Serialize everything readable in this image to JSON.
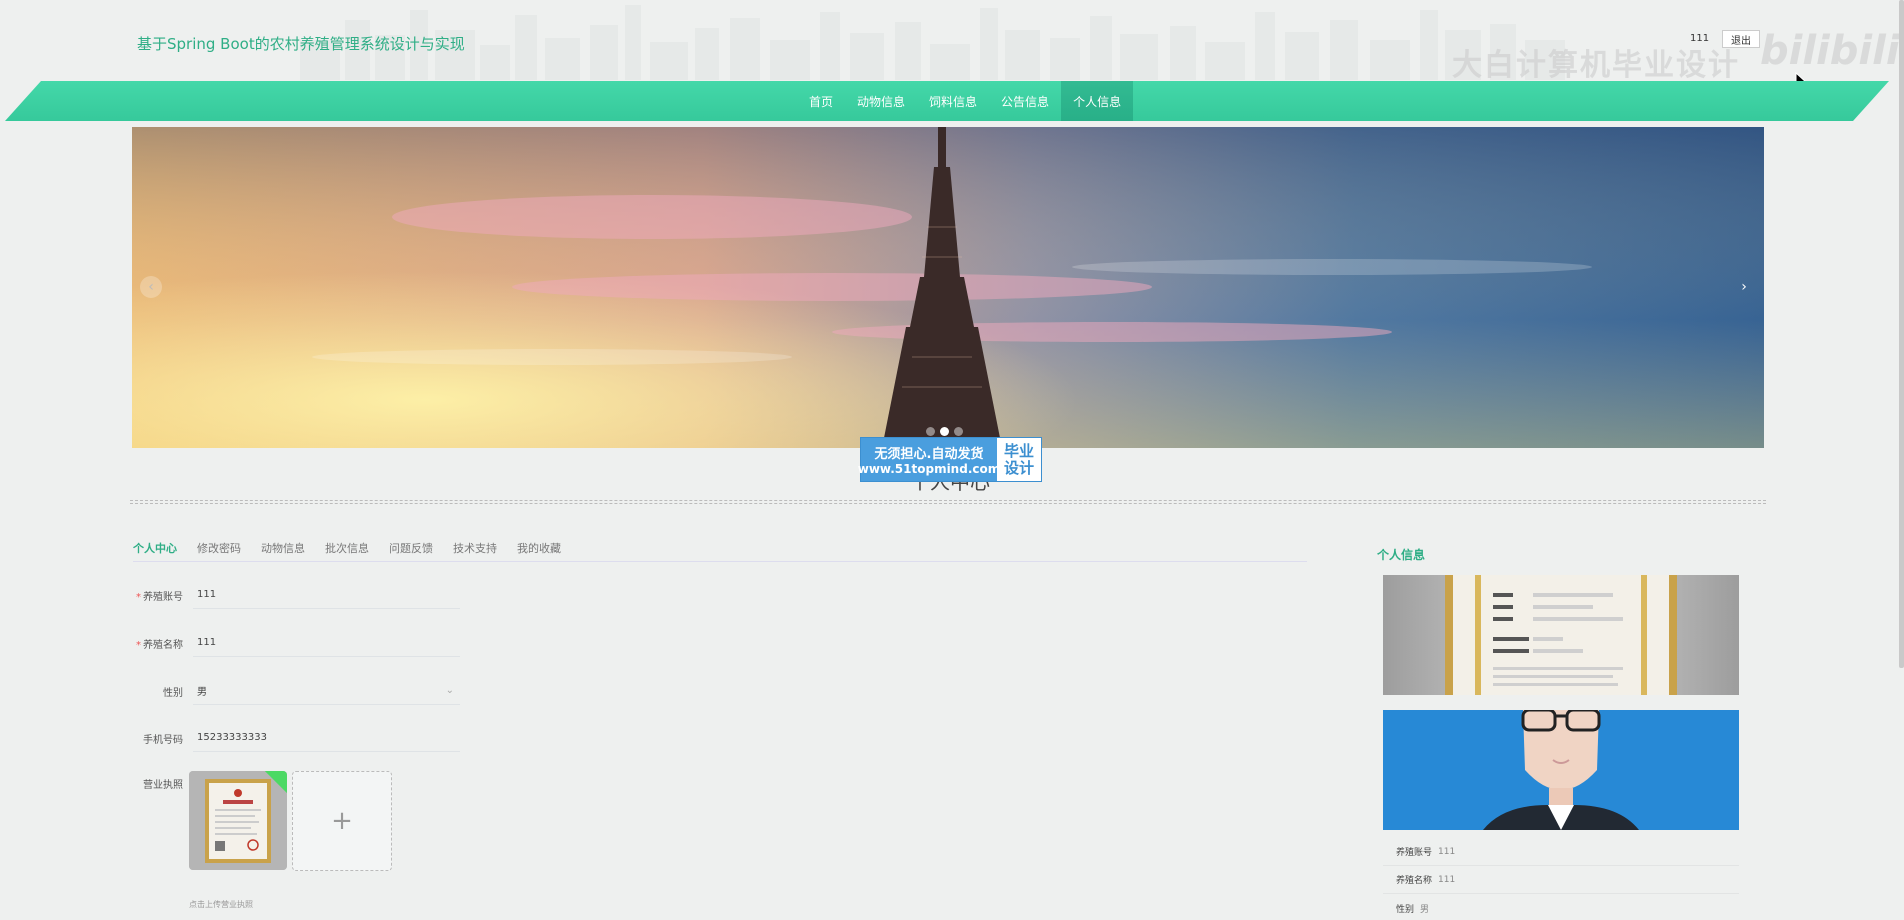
{
  "header": {
    "site_title": "基于Spring Boot的农村养殖管理系统设计与实现",
    "username": "111",
    "logout_label": "退出",
    "watermark_text": "大白计算机毕业设计",
    "watermark_logo": "bilibili"
  },
  "nav": {
    "items": [
      {
        "label": "首页"
      },
      {
        "label": "动物信息"
      },
      {
        "label": "饲料信息"
      },
      {
        "label": "公告信息"
      },
      {
        "label": "个人信息"
      }
    ],
    "active_index": 4
  },
  "banner": {
    "prev_icon": "‹",
    "next_icon": "›",
    "active_dot": 1,
    "dot_count": 3
  },
  "promo": {
    "line1": "无须担心.自动发货",
    "line2": "www.51topmind.com",
    "side_line1": "毕业",
    "side_line2": "设计"
  },
  "section_title": "个人中心",
  "tabs": [
    {
      "label": "个人中心"
    },
    {
      "label": "修改密码"
    },
    {
      "label": "动物信息"
    },
    {
      "label": "批次信息"
    },
    {
      "label": "问题反馈"
    },
    {
      "label": "技术支持"
    },
    {
      "label": "我的收藏"
    }
  ],
  "form": {
    "account_label": "养殖账号",
    "account_value": "111",
    "name_label": "养殖名称",
    "name_value": "111",
    "gender_label": "性别",
    "gender_value": "男",
    "phone_label": "手机号码",
    "phone_value": "15233333333",
    "license_label": "营业执照",
    "upload_plus": "+",
    "upload_hint": "点击上传营业执照"
  },
  "sidebar": {
    "title": "个人信息",
    "account_label": "养殖账号",
    "account_value": "111",
    "name_label": "养殖名称",
    "name_value": "111",
    "gender_label": "性别",
    "gender_value": "男"
  },
  "colors": {
    "accent": "#2fae86",
    "nav_bg": "#3fd3a4",
    "promo_blue": "#4a9ede"
  }
}
